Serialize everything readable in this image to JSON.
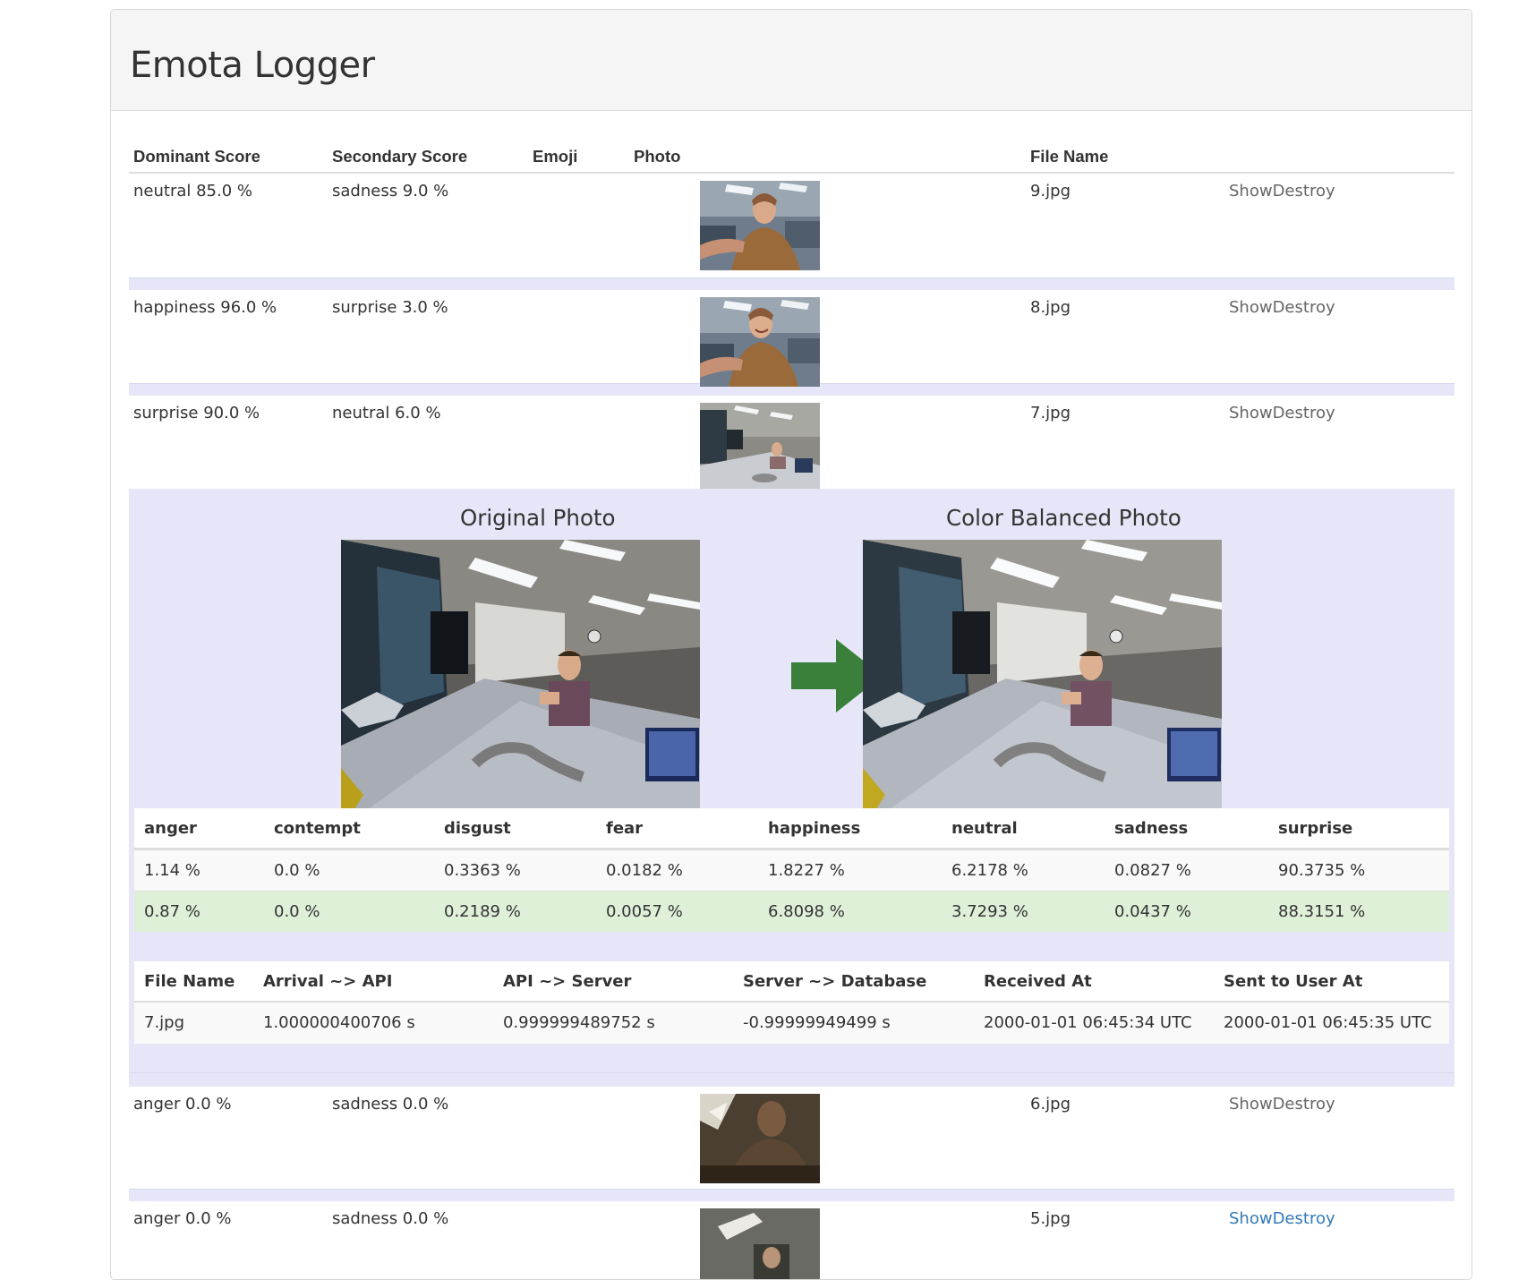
{
  "app": {
    "title": "Emota Logger"
  },
  "table": {
    "headers": {
      "dominant": "Dominant Score",
      "secondary": "Secondary Score",
      "emoji": "Emoji",
      "photo": "Photo",
      "file_name": "File Name"
    },
    "rows_top": [
      {
        "dominant": "neutral 85.0 %",
        "secondary": "sadness 9.0 %",
        "file": "9.jpg",
        "actions": "ShowDestroy"
      },
      {
        "dominant": "happiness 96.0 %",
        "secondary": "surprise 3.0 %",
        "file": "8.jpg",
        "actions": "ShowDestroy"
      },
      {
        "dominant": "surprise 90.0 %",
        "secondary": "neutral 6.0 %",
        "file": "7.jpg",
        "actions": "ShowDestroy"
      }
    ],
    "rows_bottom": [
      {
        "dominant": "anger 0.0 %",
        "secondary": "sadness 0.0 %",
        "file": "6.jpg",
        "actions": "ShowDestroy"
      },
      {
        "dominant": "anger 0.0 %",
        "secondary": "sadness 0.0 %",
        "file": "5.jpg",
        "actions": "ShowDestroy"
      }
    ]
  },
  "detail": {
    "original_caption": "Original Photo",
    "balanced_caption": "Color Balanced Photo",
    "emotion_headers": [
      "anger",
      "contempt",
      "disgust",
      "fear",
      "happiness",
      "neutral",
      "sadness",
      "surprise"
    ],
    "emotion_original": [
      "1.14 %",
      "0.0 %",
      "0.3363 %",
      "0.0182 %",
      "1.8227 %",
      "6.2178 %",
      "0.0827 %",
      "90.3735 %"
    ],
    "emotion_balanced": [
      "0.87 %",
      "0.0 %",
      "0.2189 %",
      "0.0057 %",
      "6.8098 %",
      "3.7293 %",
      "0.0437 %",
      "88.3151 %"
    ],
    "timing_headers": [
      "File Name",
      "Arrival ~> API",
      "API ~> Server",
      "Server ~> Database",
      "Received At",
      "Sent to User At"
    ],
    "timing_values": [
      "7.jpg",
      "1.000000400706 s",
      "0.999999489752 s",
      "-0.99999949499 s",
      "2000-01-01 06:45:34 UTC",
      "2000-01-01 06:45:35 UTC"
    ]
  },
  "colors": {
    "detail_bg": "#e6e6f8",
    "arrow": "#3a7f3a",
    "balanced_row": "#dff0d8",
    "link": "#337ab7"
  }
}
